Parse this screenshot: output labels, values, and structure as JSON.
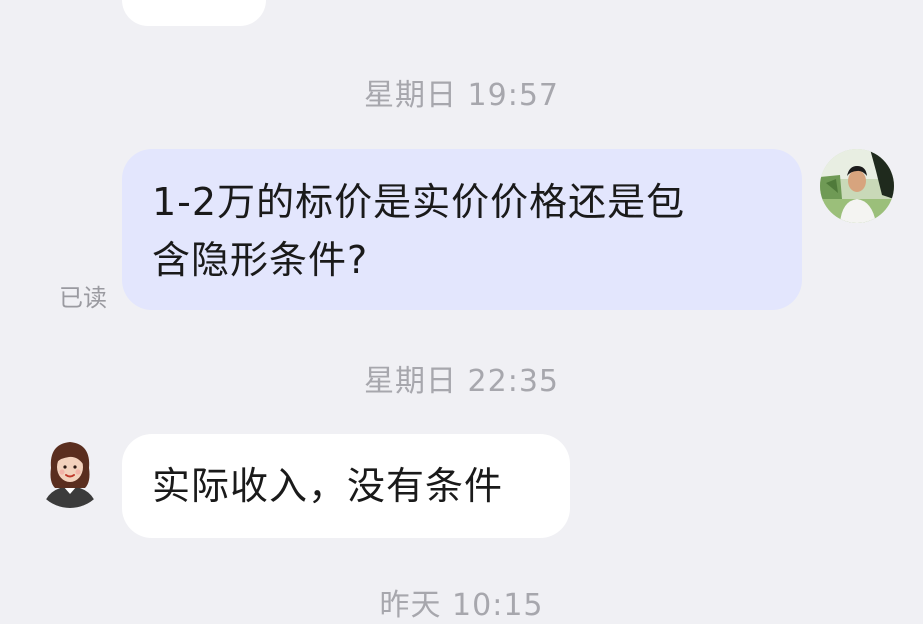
{
  "conversation": {
    "timestamps": [
      "星期日 19:57",
      "星期日 22:35",
      "昨天 10:15"
    ],
    "messages": [
      {
        "direction": "outgoing",
        "text_line1": "1-2万的标价是实价价格还是包",
        "text_line2": "含隐形条件?",
        "status": "已读"
      },
      {
        "direction": "incoming",
        "text": "实际收入，没有条件"
      }
    ]
  },
  "colors": {
    "background": "#f0f0f4",
    "outgoing_bubble": "#e3e6fd",
    "incoming_bubble": "#ffffff",
    "timestamp_text": "#a7a7ad"
  },
  "icons": {
    "my_avatar": "user-avatar-icon",
    "contact_avatar": "contact-avatar-icon"
  }
}
